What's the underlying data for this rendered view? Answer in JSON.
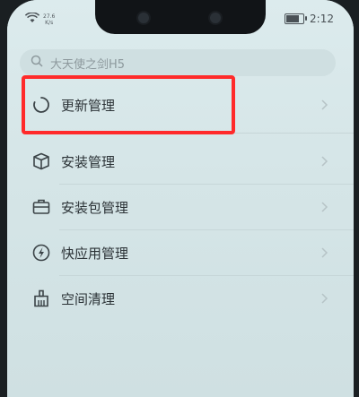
{
  "statusbar": {
    "network_speed_value": "27.6",
    "network_speed_unit": "K/s",
    "time": "2:12",
    "icons": [
      "wifi-icon",
      "battery-icon"
    ]
  },
  "search": {
    "placeholder": "大天使之剑H5",
    "icon": "search-icon"
  },
  "menu": {
    "items": [
      {
        "label": "更新管理",
        "icon": "refresh-icon"
      },
      {
        "label": "安装管理",
        "icon": "box-icon"
      },
      {
        "label": "安装包管理",
        "icon": "briefcase-icon"
      },
      {
        "label": "快应用管理",
        "icon": "lightning-icon"
      },
      {
        "label": "空间清理",
        "icon": "broom-icon"
      }
    ]
  },
  "colors": {
    "highlight": "#ff2a2a",
    "background": "#d7e6e8"
  }
}
